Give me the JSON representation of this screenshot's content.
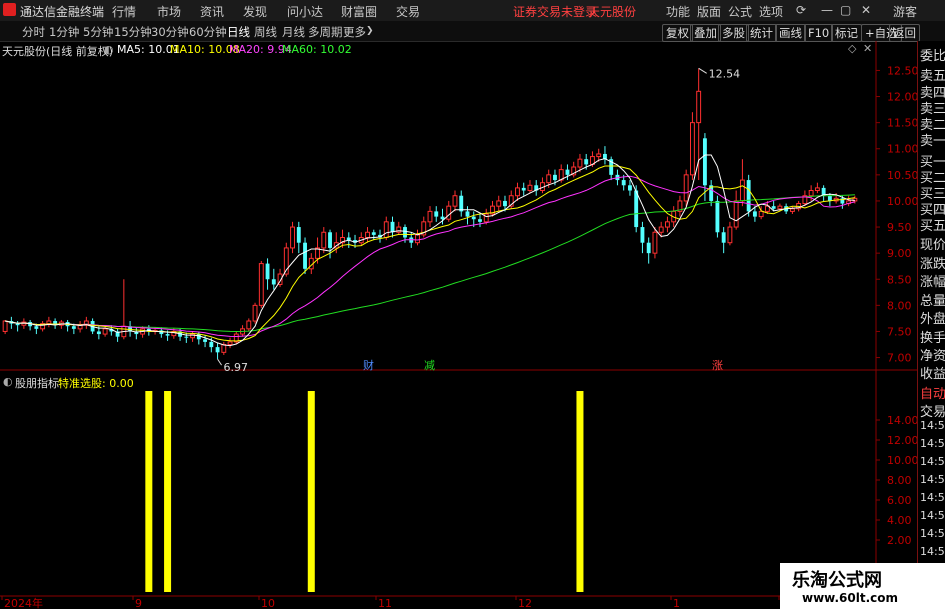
{
  "menubar": {
    "app_title": "通达信金融终端",
    "menu": [
      "行情",
      "市场",
      "资讯",
      "发现",
      "问小达",
      "财富圈",
      "交易"
    ],
    "notice": "证券交易未登录",
    "notice2": "天元股份",
    "right_menu": [
      "功能",
      "版面",
      "公式",
      "选项"
    ],
    "user": "游客",
    "colors": {
      "notice": "#ff4040",
      "logo": "#e02020"
    }
  },
  "tabbar": {
    "periods": [
      "分时",
      "1分钟",
      "5分钟",
      "15分钟",
      "30分钟",
      "60分钟",
      "日线",
      "周线",
      "月线",
      "多周期",
      "更多"
    ],
    "active_period": "日线",
    "buttons": [
      "复权",
      "叠加",
      "多股",
      "统计",
      "画线",
      "F10",
      "标记",
      "+自选",
      "返回"
    ]
  },
  "chart_header": {
    "stock": "天元股份(日线 前复权)",
    "ma5": "MA5: 10.01",
    "ma10": "MA10: 10.08",
    "ma20": "MA20: 9.94",
    "ma60": "MA60: 10.02",
    "colors": {
      "ma5": "#ffffff",
      "ma10": "#ffff00",
      "ma20": "#ff00ff",
      "ma60": "#00ff00"
    }
  },
  "indicator_header": {
    "name": "股朋指标",
    "line": "特准选股: 0.00"
  },
  "right_panel": {
    "labels": [
      "委比",
      "卖五",
      "卖四",
      "卖三",
      "卖二",
      "卖一",
      "买一",
      "买二",
      "买三",
      "买四",
      "买五",
      "现价",
      "涨跌",
      "涨幅",
      "总量",
      "外盘",
      "换手",
      "净资",
      "收益",
      "自动",
      "交易",
      "14:56",
      "14:56",
      "14:56",
      "14:56",
      "14:56",
      "14:56",
      "14:56",
      "14:56",
      "14:56",
      "14:56"
    ]
  },
  "markers": [
    "财",
    "减",
    "涨"
  ],
  "watermark": {
    "title": "乐淘公式网",
    "url": "www.60lt.com"
  },
  "chart_data": [
    {
      "type": "candlestick",
      "title": "天元股份(日线 前复权)",
      "ylim": [
        6.8,
        12.7
      ],
      "y_ticks": [
        "12.50",
        "12.00",
        "11.50",
        "11.00",
        "10.50",
        "10.00",
        "9.50",
        "9.00",
        "8.50",
        "8.00",
        "7.50",
        "7.00"
      ],
      "x_ticks": [
        "2024年",
        "9",
        "10",
        "11",
        "12",
        "1",
        "2"
      ],
      "annotations": [
        "12.54",
        "6.97"
      ],
      "candles": [
        [
          7.5,
          7.7,
          7.45,
          7.72
        ],
        [
          7.7,
          7.65,
          7.55,
          7.78
        ],
        [
          7.65,
          7.62,
          7.5,
          7.7
        ],
        [
          7.62,
          7.68,
          7.55,
          7.75
        ],
        [
          7.68,
          7.6,
          7.52,
          7.72
        ],
        [
          7.6,
          7.55,
          7.45,
          7.65
        ],
        [
          7.55,
          7.65,
          7.5,
          7.7
        ],
        [
          7.65,
          7.7,
          7.58,
          7.78
        ],
        [
          7.7,
          7.62,
          7.55,
          7.75
        ],
        [
          7.62,
          7.68,
          7.55,
          7.72
        ],
        [
          7.68,
          7.6,
          7.5,
          7.72
        ],
        [
          7.6,
          7.55,
          7.45,
          7.65
        ],
        [
          7.55,
          7.62,
          7.48,
          7.7
        ],
        [
          7.62,
          7.7,
          7.55,
          7.78
        ],
        [
          7.7,
          7.5,
          7.45,
          7.75
        ],
        [
          7.5,
          7.45,
          7.35,
          7.6
        ],
        [
          7.45,
          7.55,
          7.4,
          7.6
        ],
        [
          7.55,
          7.5,
          7.42,
          7.62
        ],
        [
          7.5,
          7.4,
          7.3,
          7.55
        ],
        [
          7.4,
          7.6,
          7.35,
          8.5
        ],
        [
          7.6,
          7.5,
          7.4,
          7.7
        ],
        [
          7.5,
          7.45,
          7.35,
          7.58
        ],
        [
          7.45,
          7.55,
          7.38,
          7.6
        ],
        [
          7.55,
          7.5,
          7.42,
          7.62
        ],
        [
          7.5,
          7.52,
          7.44,
          7.58
        ],
        [
          7.52,
          7.45,
          7.38,
          7.58
        ],
        [
          7.45,
          7.42,
          7.32,
          7.52
        ],
        [
          7.42,
          7.5,
          7.36,
          7.56
        ],
        [
          7.5,
          7.4,
          7.32,
          7.55
        ],
        [
          7.4,
          7.38,
          7.28,
          7.48
        ],
        [
          7.38,
          7.45,
          7.3,
          7.5
        ],
        [
          7.45,
          7.35,
          7.25,
          7.5
        ],
        [
          7.35,
          7.3,
          7.2,
          7.42
        ],
        [
          7.3,
          7.2,
          7.1,
          7.38
        ],
        [
          7.2,
          7.1,
          6.97,
          7.28
        ],
        [
          7.1,
          7.25,
          7.05,
          7.3
        ],
        [
          7.25,
          7.3,
          7.18,
          7.38
        ],
        [
          7.3,
          7.45,
          7.25,
          7.5
        ],
        [
          7.45,
          7.55,
          7.4,
          7.62
        ],
        [
          7.55,
          7.7,
          7.5,
          7.75
        ],
        [
          7.7,
          8.0,
          7.65,
          8.05
        ],
        [
          8.0,
          8.8,
          7.95,
          8.85
        ],
        [
          8.8,
          8.5,
          8.3,
          8.9
        ],
        [
          8.5,
          8.4,
          8.3,
          8.7
        ],
        [
          8.4,
          8.6,
          8.35,
          8.7
        ],
        [
          8.6,
          9.1,
          8.55,
          9.2
        ],
        [
          9.1,
          9.5,
          9.0,
          9.6
        ],
        [
          9.5,
          9.2,
          9.0,
          9.6
        ],
        [
          9.2,
          8.7,
          8.6,
          9.3
        ],
        [
          8.7,
          8.9,
          8.6,
          9.0
        ],
        [
          8.9,
          9.1,
          8.8,
          9.3
        ],
        [
          9.1,
          9.4,
          9.0,
          9.5
        ],
        [
          9.4,
          9.1,
          8.9,
          9.45
        ],
        [
          9.1,
          9.2,
          9.0,
          9.4
        ],
        [
          9.2,
          9.3,
          9.1,
          9.45
        ],
        [
          9.3,
          9.25,
          9.1,
          9.4
        ],
        [
          9.25,
          9.2,
          9.1,
          9.35
        ],
        [
          9.2,
          9.3,
          9.15,
          9.4
        ],
        [
          9.3,
          9.4,
          9.2,
          9.5
        ],
        [
          9.4,
          9.35,
          9.25,
          9.45
        ],
        [
          9.35,
          9.3,
          9.2,
          9.45
        ],
        [
          9.3,
          9.6,
          9.25,
          9.7
        ],
        [
          9.6,
          9.4,
          9.3,
          9.7
        ],
        [
          9.4,
          9.5,
          9.35,
          9.6
        ],
        [
          9.5,
          9.3,
          9.2,
          9.55
        ],
        [
          9.3,
          9.2,
          9.1,
          9.4
        ],
        [
          9.2,
          9.35,
          9.15,
          9.45
        ],
        [
          9.35,
          9.6,
          9.3,
          9.7
        ],
        [
          9.6,
          9.8,
          9.5,
          9.9
        ],
        [
          9.8,
          9.7,
          9.6,
          9.9
        ],
        [
          9.7,
          9.65,
          9.55,
          9.85
        ],
        [
          9.65,
          9.9,
          9.6,
          10.0
        ],
        [
          9.9,
          10.1,
          9.8,
          10.2
        ],
        [
          10.1,
          9.8,
          9.7,
          10.2
        ],
        [
          9.8,
          9.7,
          9.55,
          9.9
        ],
        [
          9.7,
          9.65,
          9.5,
          9.8
        ],
        [
          9.65,
          9.6,
          9.5,
          9.75
        ],
        [
          9.6,
          9.75,
          9.55,
          9.85
        ],
        [
          9.75,
          9.9,
          9.7,
          10.0
        ],
        [
          9.9,
          10.0,
          9.8,
          10.1
        ],
        [
          10.0,
          9.9,
          9.8,
          10.1
        ],
        [
          9.9,
          10.1,
          9.85,
          10.2
        ],
        [
          10.1,
          10.25,
          10.0,
          10.35
        ],
        [
          10.25,
          10.2,
          10.1,
          10.35
        ],
        [
          10.2,
          10.3,
          10.15,
          10.4
        ],
        [
          10.3,
          10.2,
          10.1,
          10.4
        ],
        [
          10.2,
          10.35,
          10.15,
          10.45
        ],
        [
          10.35,
          10.5,
          10.25,
          10.6
        ],
        [
          10.5,
          10.4,
          10.3,
          10.6
        ],
        [
          10.4,
          10.6,
          10.35,
          10.7
        ],
        [
          10.6,
          10.5,
          10.4,
          10.7
        ],
        [
          10.5,
          10.65,
          10.45,
          10.75
        ],
        [
          10.65,
          10.8,
          10.55,
          10.9
        ],
        [
          10.8,
          10.7,
          10.6,
          10.9
        ],
        [
          10.7,
          10.85,
          10.65,
          10.95
        ],
        [
          10.85,
          10.9,
          10.75,
          11.0
        ],
        [
          10.9,
          10.8,
          10.7,
          11.05
        ],
        [
          10.8,
          10.5,
          10.4,
          10.85
        ],
        [
          10.5,
          10.4,
          10.3,
          10.6
        ],
        [
          10.4,
          10.3,
          10.2,
          10.5
        ],
        [
          10.3,
          10.2,
          10.1,
          10.4
        ],
        [
          10.2,
          9.5,
          9.4,
          10.3
        ],
        [
          9.5,
          9.2,
          9.0,
          9.6
        ],
        [
          9.2,
          9.0,
          8.8,
          9.3
        ],
        [
          9.0,
          9.4,
          8.9,
          9.5
        ],
        [
          9.4,
          9.5,
          9.3,
          9.6
        ],
        [
          9.5,
          9.6,
          9.4,
          9.7
        ],
        [
          9.6,
          9.8,
          9.5,
          9.9
        ],
        [
          9.8,
          10.0,
          9.7,
          10.1
        ],
        [
          10.0,
          10.5,
          9.9,
          10.6
        ],
        [
          10.5,
          11.5,
          10.4,
          11.7
        ],
        [
          11.5,
          12.1,
          10.4,
          12.54
        ],
        [
          11.2,
          10.3,
          10.0,
          11.3
        ],
        [
          10.3,
          10.0,
          9.9,
          10.4
        ],
        [
          10.0,
          9.4,
          9.3,
          10.1
        ],
        [
          9.4,
          9.2,
          9.0,
          9.5
        ],
        [
          9.2,
          9.5,
          9.15,
          9.6
        ],
        [
          9.5,
          10.0,
          9.45,
          10.2
        ],
        [
          10.0,
          10.4,
          9.9,
          10.8
        ],
        [
          10.4,
          9.8,
          9.7,
          10.5
        ],
        [
          9.8,
          9.7,
          9.6,
          9.9
        ],
        [
          9.7,
          9.8,
          9.65,
          9.9
        ],
        [
          9.8,
          9.9,
          9.75,
          10.0
        ],
        [
          9.9,
          9.85,
          9.8,
          10.0
        ],
        [
          9.85,
          9.9,
          9.8,
          9.95
        ],
        [
          9.9,
          9.8,
          9.75,
          9.95
        ],
        [
          9.8,
          9.85,
          9.75,
          9.9
        ],
        [
          9.85,
          9.95,
          9.8,
          10.0
        ],
        [
          9.95,
          10.1,
          9.9,
          10.2
        ],
        [
          10.1,
          10.2,
          10.0,
          10.3
        ],
        [
          10.2,
          10.25,
          10.15,
          10.35
        ],
        [
          10.25,
          10.1,
          10.0,
          10.3
        ],
        [
          10.1,
          10.0,
          9.9,
          10.15
        ],
        [
          10.0,
          10.05,
          9.95,
          10.15
        ],
        [
          10.05,
          9.95,
          9.85,
          10.1
        ],
        [
          9.95,
          10.0,
          9.9,
          10.1
        ],
        [
          10.0,
          10.05,
          9.95,
          10.1
        ]
      ]
    },
    {
      "type": "bar",
      "name": "特准选股",
      "ylim": [
        0,
        16
      ],
      "y_ticks": [
        "14.00",
        "12.00",
        "10.00",
        "8.00",
        "6.00",
        "4.00",
        "2.00"
      ],
      "signal_indices": [
        23,
        26,
        49,
        92,
        155,
        175
      ],
      "signal_value": 16
    }
  ]
}
